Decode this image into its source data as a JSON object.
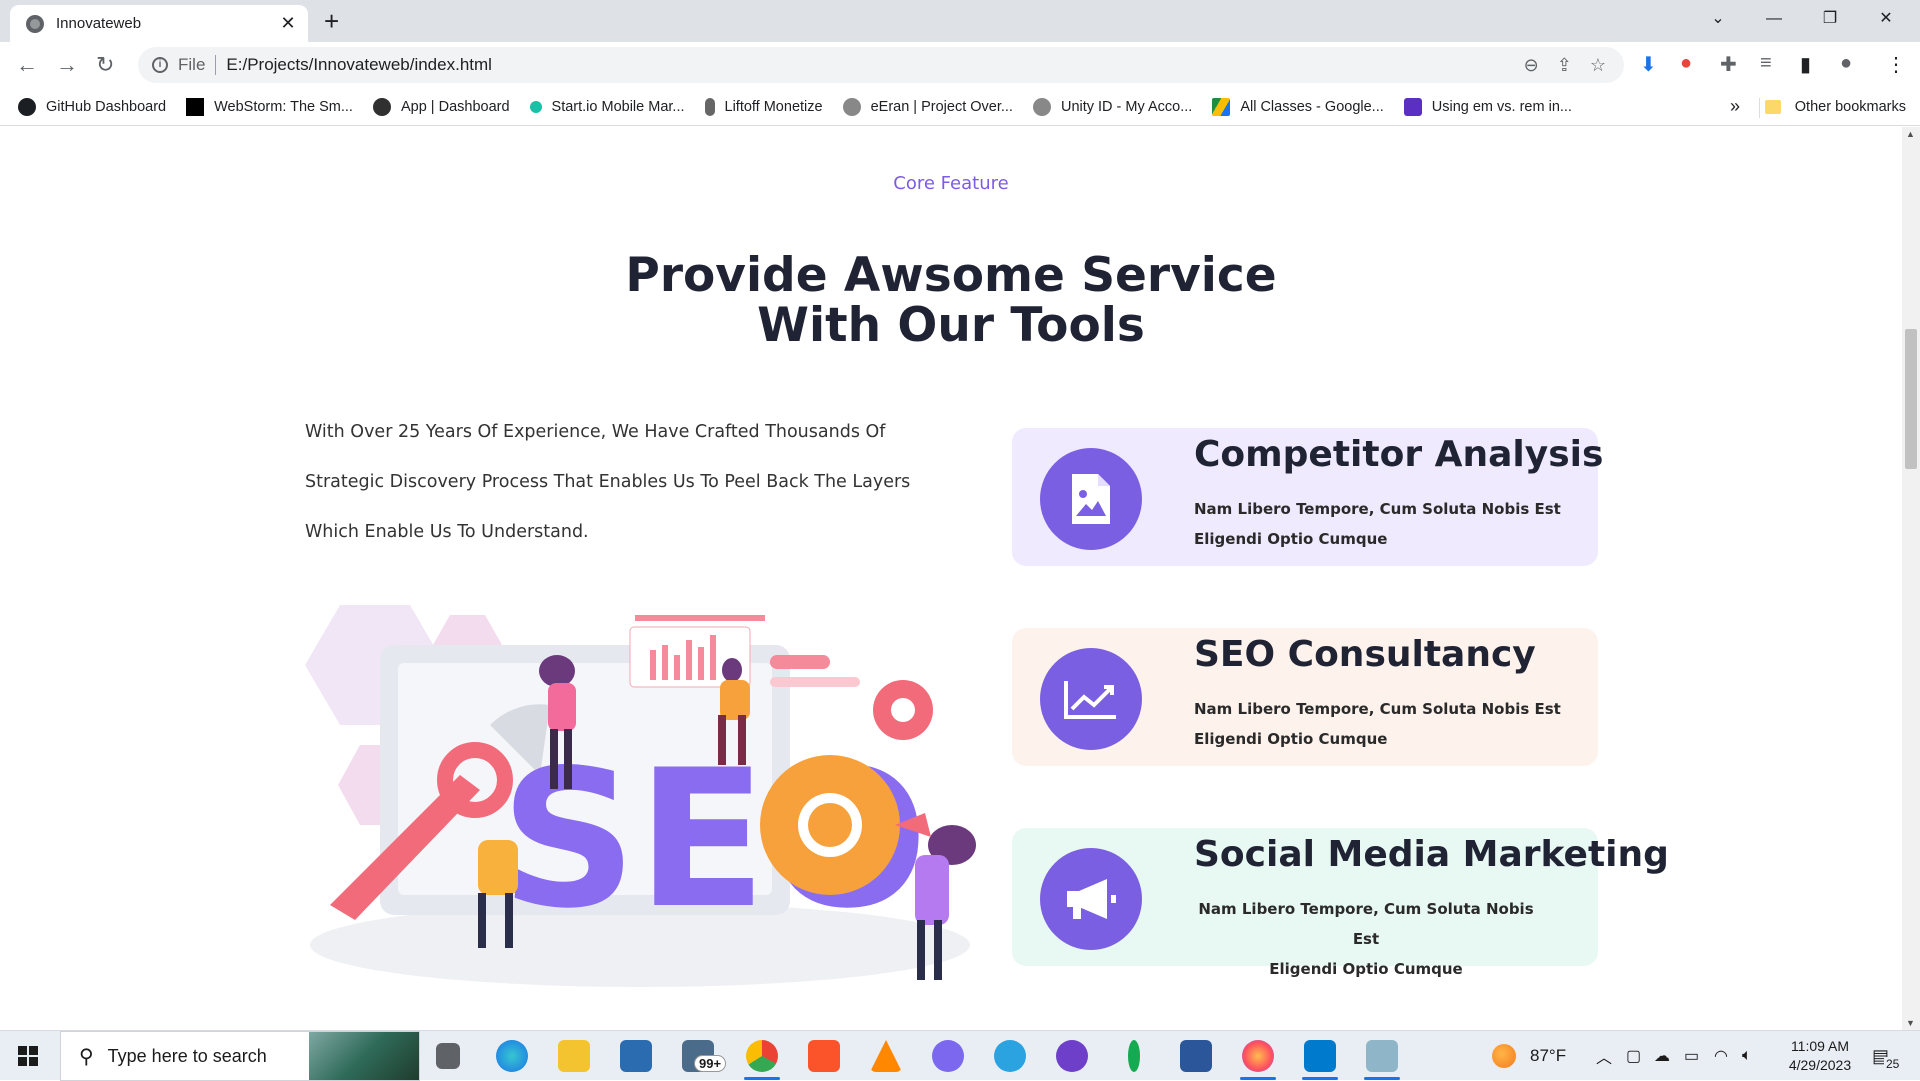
{
  "browser": {
    "tab_title": "Innovateweb",
    "tab_close": "✕",
    "new_tab": "+",
    "address_scheme": "File",
    "address_url": "E:/Projects/Innovateweb/index.html",
    "window_controls": {
      "dropdown": "⌄",
      "minimize": "—",
      "restore": "❐",
      "close": "✕"
    }
  },
  "bookmarks": [
    {
      "label": "GitHub Dashboard",
      "color": "#1b1f23"
    },
    {
      "label": "WebStorm: The Sm...",
      "color": "#000000"
    },
    {
      "label": "App | Dashboard",
      "color": "#303030"
    },
    {
      "label": "Start.io Mobile Mar...",
      "color": "#19c0a8"
    },
    {
      "label": "Liftoff Monetize",
      "color": "#555555"
    },
    {
      "label": "eEran | Project Over...",
      "color": "#777777"
    },
    {
      "label": "Unity ID - My Acco...",
      "color": "#777777"
    },
    {
      "label": "All Classes - Google...",
      "color": "#1e8e3e"
    },
    {
      "label": "Using em vs. rem in...",
      "color": "#5a2fc2"
    }
  ],
  "bookmarks_more": "»",
  "other_bookmarks": "Other bookmarks",
  "page": {
    "kicker": "Core Feature",
    "headline_line1": "Provide Awsome Service",
    "headline_line2": "With Our Tools",
    "paragraph": "With Over 25 Years Of Experience, We Have Crafted Thousands Of Strategic Discovery Process That Enables Us To Peel Back The Layers Which Enable Us To Understand.",
    "illustration_text": "SEO",
    "cards": [
      {
        "title": "Competitor Analysis",
        "desc_line1": "Nam Libero Tempore, Cum Soluta Nobis Est",
        "desc_line2": "Eligendi Optio Cumque",
        "bg": "#efeafd",
        "icon": "image-file-icon"
      },
      {
        "title": "SEO Consultancy",
        "desc_line1": "Nam Libero Tempore, Cum Soluta Nobis Est",
        "desc_line2": "Eligendi Optio Cumque",
        "bg": "#fdf3ec",
        "icon": "chart-icon"
      },
      {
        "title": "Social Media Marketing",
        "desc_line1": "Nam Libero Tempore, Cum Soluta Nobis Est",
        "desc_line2": "Eligendi Optio Cumque",
        "bg": "#e8f8f2",
        "icon": "megaphone-icon"
      }
    ],
    "accent_color": "#7a5fe3"
  },
  "taskbar": {
    "search_placeholder": "Type here to search",
    "mail_badge": "99+",
    "weather": "87°F",
    "time": "11:09 AM",
    "date": "4/29/2023",
    "notifications": "25"
  }
}
